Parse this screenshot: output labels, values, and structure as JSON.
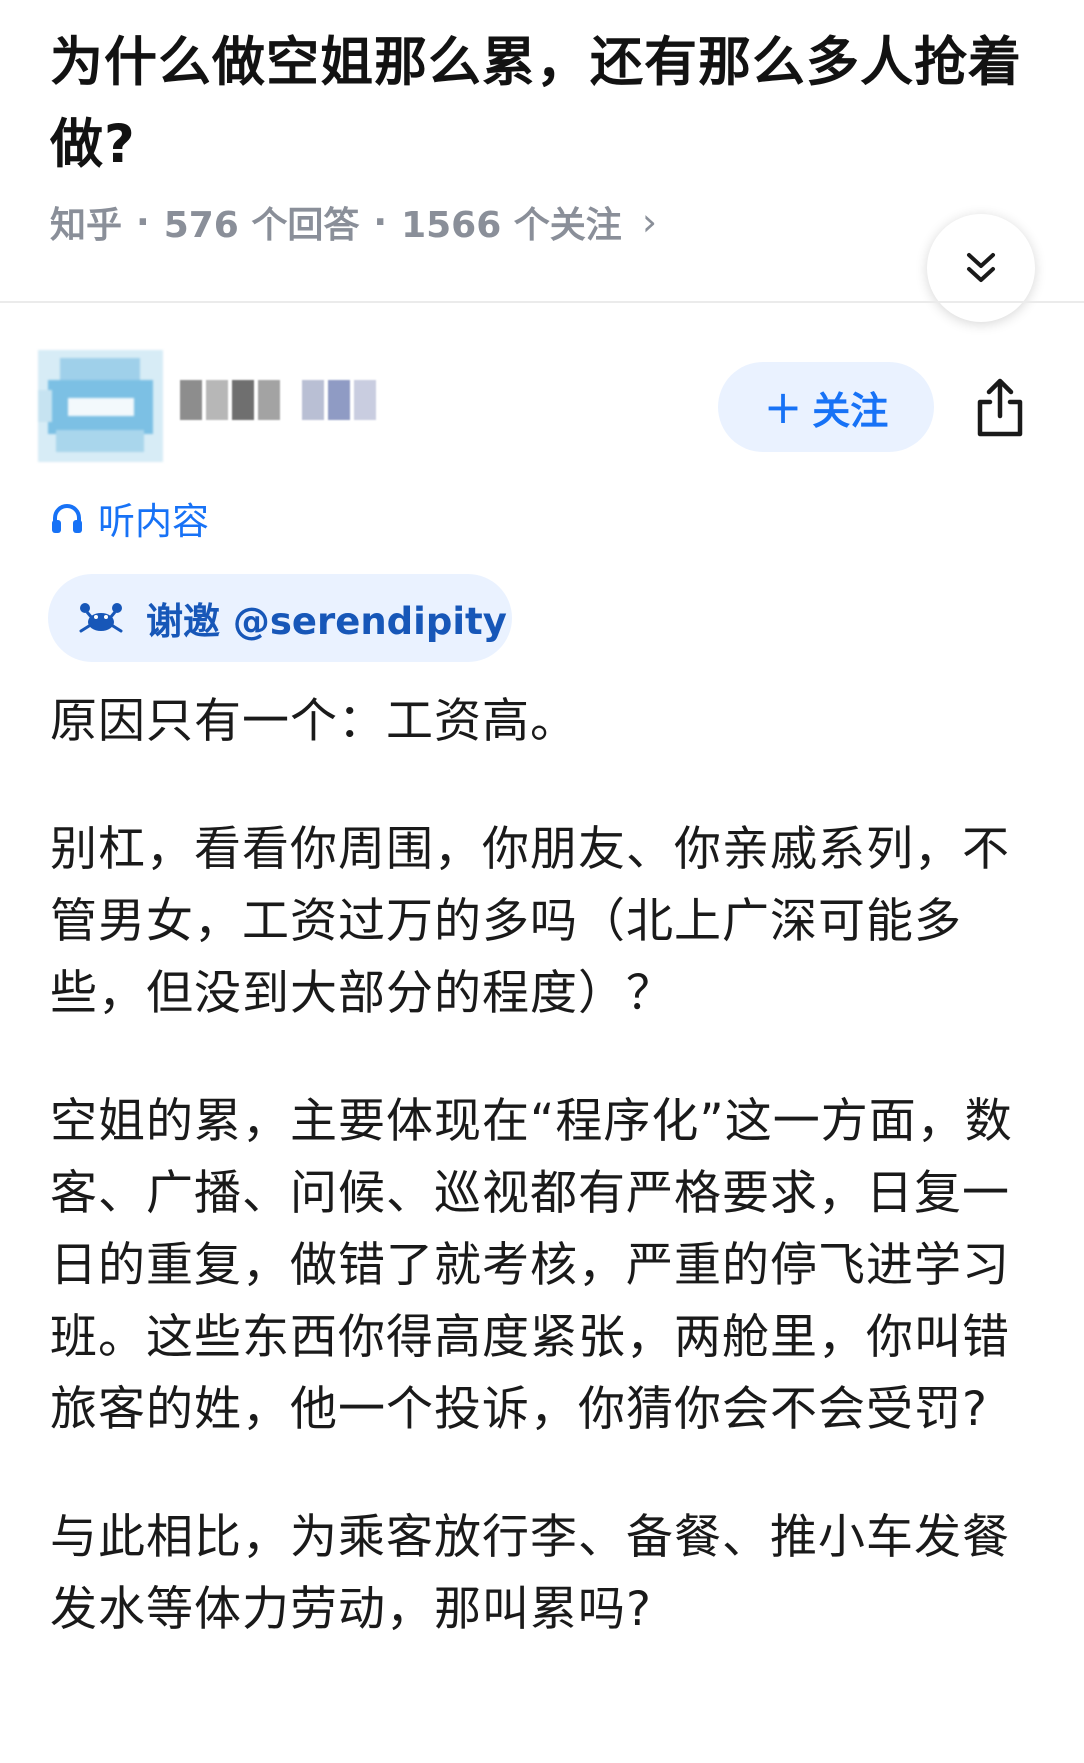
{
  "question": {
    "title": "为什么做空姐那么累，还有那么多人抢着做?",
    "source": "知乎",
    "answers": "576 个回答",
    "followers": "1566 个关注",
    "separator": "·",
    "chevron": "›"
  },
  "collapse_icon": "double-chevron-down-icon",
  "author": {
    "follow_plus": "+",
    "follow_label": "关注"
  },
  "share_icon": "share-icon",
  "listen": {
    "icon": "headphones-icon",
    "label": "听内容"
  },
  "invite": {
    "icon": "crab-icon",
    "label": "谢邀 @serendipity"
  },
  "answer": {
    "paragraphs": [
      "原因只有一个：工资高。",
      "别杠，看看你周围，你朋友、你亲戚系列，不管男女，工资过万的多吗（北上广深可能多些，但没到大部分的程度）？",
      "空姐的累，主要体现在“程序化”这一方面，数客、广播、问候、巡视都有严格要求，日复一日的重复，做错了就考核，严重的停飞进学习班。这些东西你得高度紧张，两舱里，你叫错旅客的姓，他一个投诉，你猜你会不会受罚?",
      "与此相比，为乘客放行李、备餐、推小车发餐发水等体力劳动，那叫累吗?"
    ]
  },
  "colors": {
    "accent_blue": "#1772f6",
    "pill_bg": "#eaf2ff",
    "meta_gray": "#8a8f99",
    "title_text": "#121212"
  }
}
